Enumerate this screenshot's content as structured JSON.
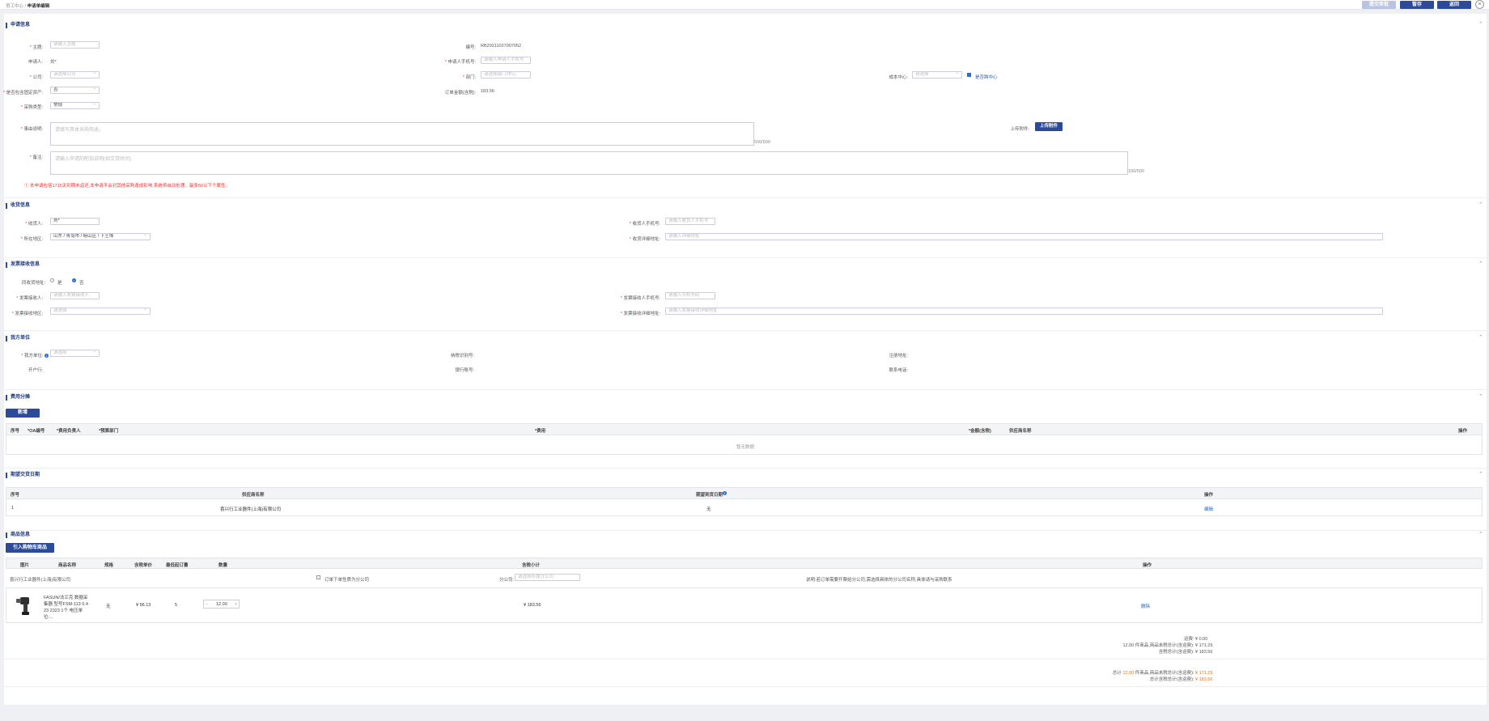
{
  "header": {
    "breadcrumb_parent": "员工中心",
    "breadcrumb_sep": "/",
    "breadcrumb_current": "申请单编辑",
    "btn_submit": "提交审批",
    "btn_save": "暂存",
    "btn_back": "返回",
    "close_glyph": "×"
  },
  "colors": {
    "primary": "#2b4a9a",
    "disabled": "#b8c4e0",
    "accent": "#ff6a00",
    "error": "#e33333"
  },
  "apply": {
    "title": "申请信息",
    "subject_label": "主题:",
    "subject_placeholder": "请输入主题",
    "number_label": "编号:",
    "number_value": "RB20211027007052",
    "applicant_label": "申请人:",
    "applicant_value": "刘*",
    "applicant_phone_label": "申请人手机号:",
    "applicant_phone_placeholder": "请输入申请人手机号",
    "company_label": "公司:",
    "company_placeholder": "请选择公司",
    "dept_label": "部门:",
    "dept_placeholder": "请选择部门/中心",
    "cost_center_label": "成本中心:",
    "cost_center_placeholder": "请选择",
    "cost_center_check_label": "是否跨中心",
    "fixed_asset_label": "是否包含固定资产:",
    "fixed_asset_value": "否",
    "order_amount_label": "订单金额(含税):",
    "order_amount_value": "183.56",
    "purchase_type_label": "采购类型:",
    "purchase_type_value": "常规",
    "reason_label": "事由说明:",
    "reason_placeholder": "请填写具体采购用途。",
    "reason_count": "500/500",
    "attach_label": "上传附件:",
    "attach_button": "上传附件",
    "remark_label": "备注:",
    "remark_placeholder": "请输入申请的附加说明(如交货时间)",
    "remark_count": "100/500",
    "warning": "①  本申请包括1715天到期未返还,本申请不会对其他采购造成影响,系统将自动处理。最多50以下个属性。"
  },
  "receive": {
    "title": "收货信息",
    "receiver_label": "收货人:",
    "receiver_value": "刘*",
    "phone_label": "收货人手机号:",
    "phone_placeholder": "请输入收货人手机号",
    "region_label": "所在地区:",
    "region_value": "山东 / 青岛市 / 崂山区 / 下王埠",
    "address_label": "收货详细地址:",
    "address_placeholder": "请输入详细地址"
  },
  "invoice": {
    "title": "发票接收信息",
    "same_label": "同收货地址:",
    "opt_yes": "是",
    "opt_no": "否",
    "receiver_label": "发票接收人:",
    "receiver_placeholder": "请输入发票接收人",
    "phone_label": "发票接收人手机号:",
    "phone_placeholder": "请输入手机号码",
    "region_label": "发票接收地区:",
    "region_placeholder": "请选择",
    "address_label": "发票接收详细地址:",
    "address_placeholder": "请输入发票接收详细地址"
  },
  "buyer": {
    "title": "我方单位",
    "unit_label": "我方单位:",
    "unit_placeholder": "请选择",
    "tax_label": "纳税识别号:",
    "reg_addr_label": "注册地址:",
    "account_label": "开户行:",
    "bank_label": "银行账号:",
    "phone_label": "联系电话:"
  },
  "cost": {
    "title": "费用分摊",
    "add_button": "新增",
    "columns": [
      "序号",
      "*OA编号",
      "*费用负责人",
      "*预算部门",
      "*费用",
      "*金额(含税)",
      "供应商名称",
      "操作"
    ],
    "empty": "暂无数据"
  },
  "delivery": {
    "title": "期望交货日期",
    "columns": [
      "序号",
      "供应商名称",
      "期望到货日期",
      "操作"
    ],
    "rows": [
      {
        "index": "1",
        "supplier": "喜兴行工业器件(上海)有限公司",
        "date": "无",
        "action": "编辑"
      }
    ]
  },
  "goods": {
    "title": "商品信息",
    "import_button": "引入购物车商品",
    "columns": [
      "图片",
      "商品名称",
      "规格",
      "含税单价",
      "最低起订量",
      "数量",
      "含税小计",
      "操作"
    ],
    "supplier_name": "喜兴行工业器件(上海)有限公司",
    "split_check_label": "订单下单性质为分公司",
    "branch_label": "分公司:",
    "branch_placeholder": "请选择所属分公司",
    "hint": "说明:若订单需要开票给分公司,需选择具体的分公司名称,具体请与采购联系",
    "items": [
      {
        "name": "FASUN/法兰克 数据采集器 型号FSM-113 0.4 23 2323 1个 电压单位:...",
        "spec": "无",
        "price": "¥ 56.13",
        "moq": "5",
        "qty": "12.00",
        "subtotal": "¥ 183.56",
        "action": "删除"
      }
    ],
    "freight_label": "运费:",
    "freight_value": "¥ 0.00",
    "sum1_label": "12.00 件商品,商品未税总计(含运费):",
    "sum1_value": "¥ 171.29",
    "sum2_label": "含税总计(含运费):",
    "sum2_value": "¥ 183.56",
    "total_prefix": "总计",
    "total_count": "12.00",
    "total_mid": "件商品,商品未税总计(含运费):",
    "total_notax": "¥ 171.29",
    "total_tax_label": "总计含税总计(含运费):",
    "total_tax": "¥ 183.56"
  }
}
